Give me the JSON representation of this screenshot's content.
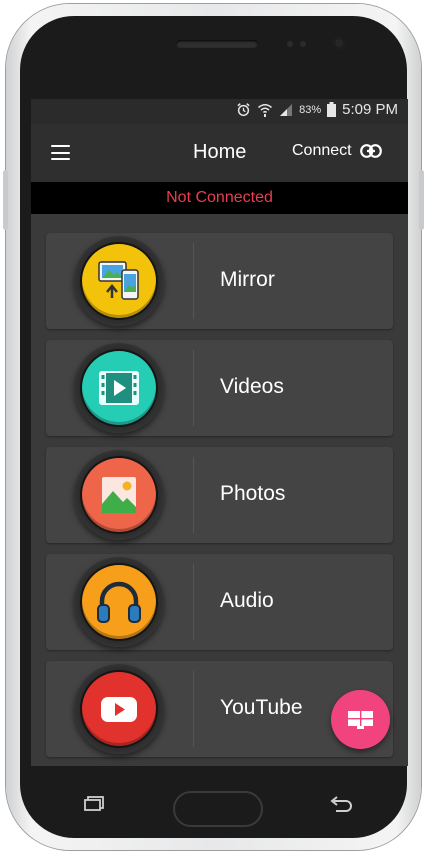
{
  "status_bar": {
    "battery_percent": "83%",
    "time": "5:09 PM",
    "icons": [
      "alarm-icon",
      "wifi-icon",
      "signal-icon",
      "battery-icon"
    ]
  },
  "app_bar": {
    "title": "Home",
    "connect_label": "Connect"
  },
  "connection": {
    "status": "Not Connected",
    "status_color": "#ea3d4e"
  },
  "menu_items": [
    {
      "label": "Mirror",
      "icon": "mirror-icon",
      "color": "#f3c20b"
    },
    {
      "label": "Videos",
      "icon": "videos-icon",
      "color": "#26cdb5"
    },
    {
      "label": "Photos",
      "icon": "photos-icon",
      "color": "#ee6549"
    },
    {
      "label": "Audio",
      "icon": "audio-icon",
      "color": "#f79f1a"
    },
    {
      "label": "YouTube",
      "icon": "youtube-icon",
      "color": "#e2322d"
    }
  ],
  "fab": {
    "icon": "cast-screen-icon",
    "color": "#f1437e"
  },
  "nav_bar": {
    "icons": [
      "recent-apps-icon",
      "home-button",
      "back-icon"
    ]
  }
}
